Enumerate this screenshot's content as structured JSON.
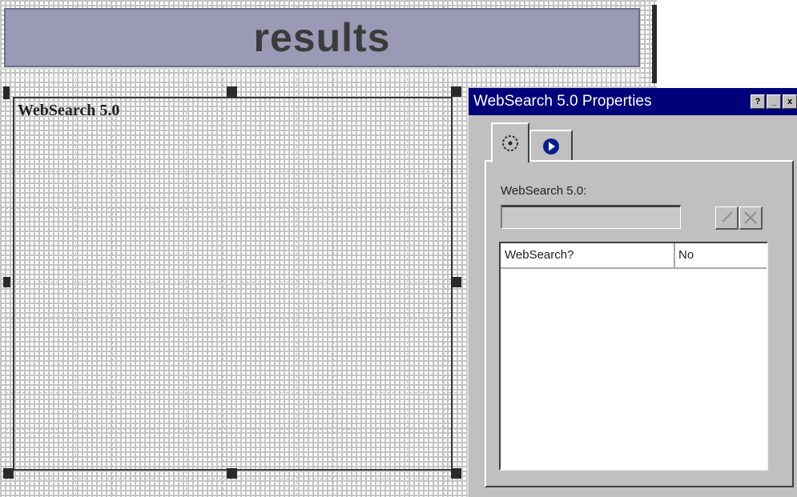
{
  "banner": {
    "title": "results"
  },
  "widget": {
    "label": "WebSearch 5.0"
  },
  "dialog": {
    "title": "WebSearch 5.0 Properties",
    "titlebar_buttons": {
      "help": "?",
      "minimize": "_",
      "close": "x"
    },
    "tabs": [
      {
        "icon": "target-circle-icon",
        "selected": true
      },
      {
        "icon": "play-circle-icon",
        "selected": false
      }
    ],
    "field_label": "WebSearch 5.0:",
    "field_value": "",
    "buttons": {
      "accept_icon": "checkmark-icon",
      "cancel_icon": "x-icon"
    },
    "properties": [
      {
        "name": "WebSearch?",
        "value": "No"
      }
    ],
    "colors": {
      "titlebar": "#00007a",
      "banner": "#9a9ab6"
    }
  }
}
